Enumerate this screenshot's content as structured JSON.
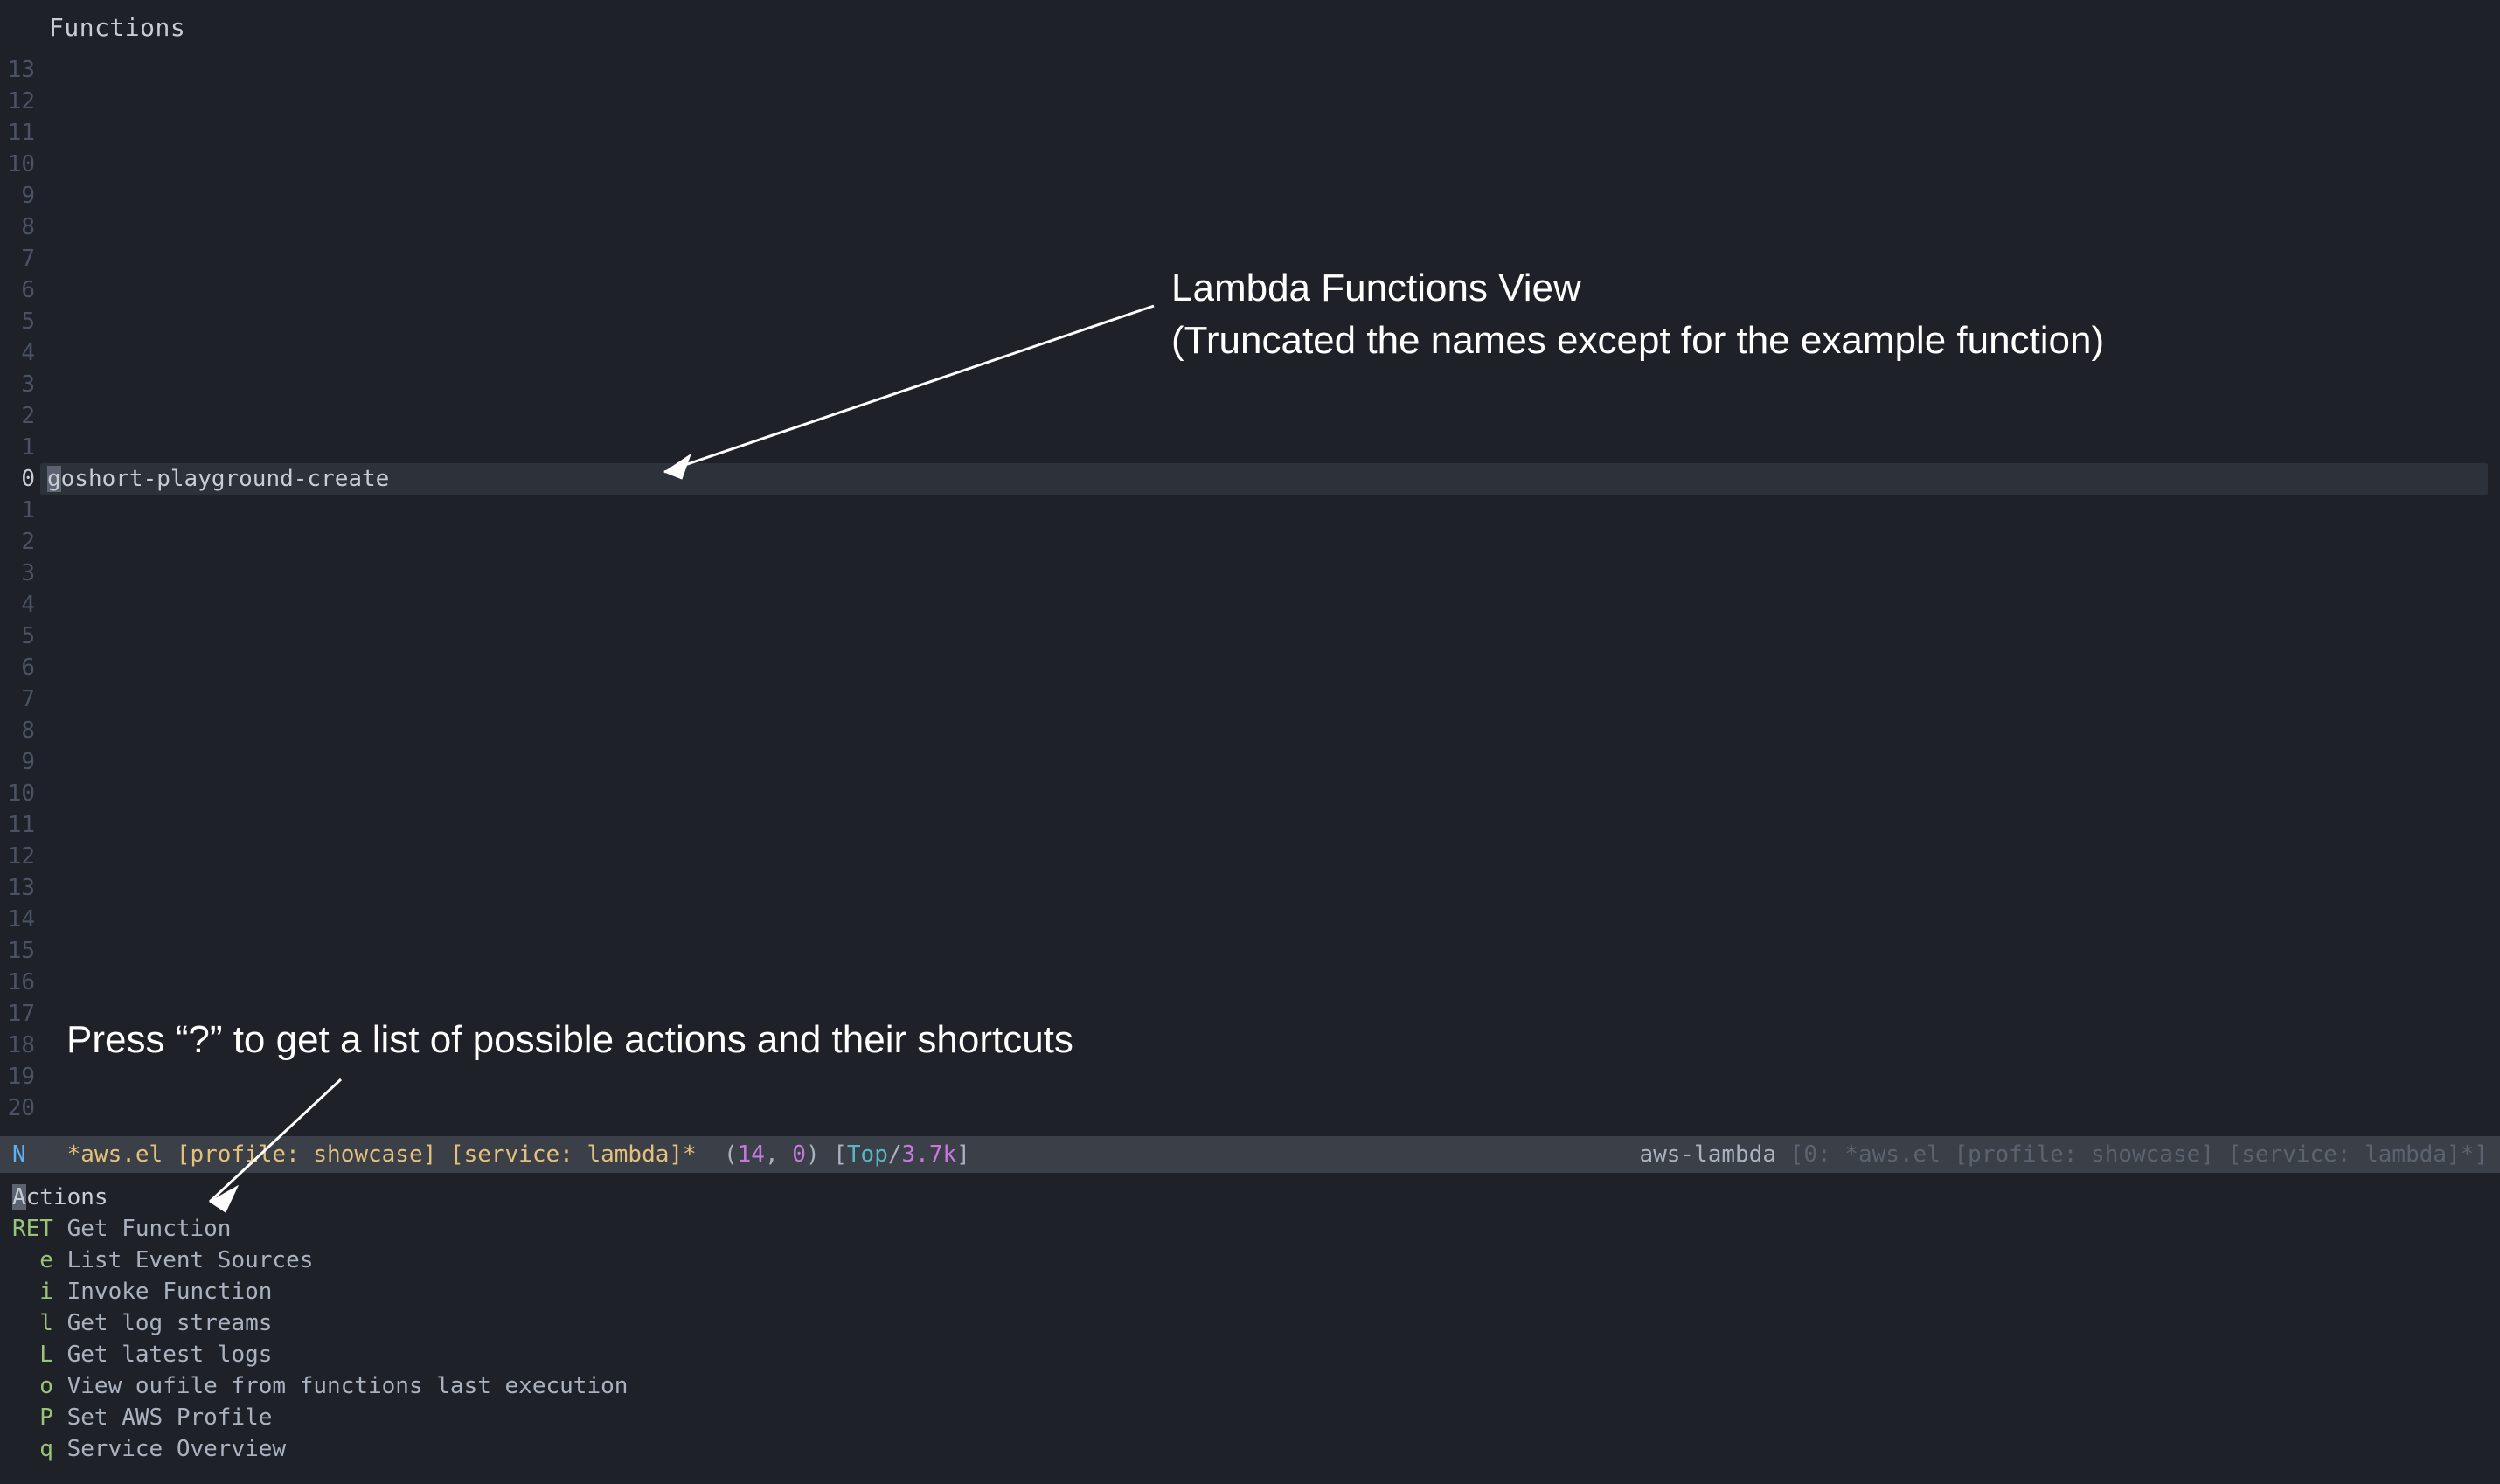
{
  "header": {
    "title": "Functions"
  },
  "gutter": {
    "lines": [
      "13",
      "12",
      "11",
      "10",
      "9",
      "8",
      "7",
      "6",
      "5",
      "4",
      "3",
      "2",
      "1",
      "0",
      "1",
      "2",
      "3",
      "4",
      "5",
      "6",
      "7",
      "8",
      "9",
      "10",
      "11",
      "12",
      "13",
      "14",
      "15",
      "16",
      "17",
      "18",
      "19",
      "20"
    ],
    "currentIndex": 13
  },
  "currentLine": {
    "first_char": "g",
    "rest": "oshort-playground-create"
  },
  "modeline": {
    "mode": "N",
    "buffer": "*aws.el [profile: showcase] [service: lambda]*",
    "row": "14",
    "col": "0",
    "pos": "Top",
    "size": "3.7k",
    "right_mode": "aws-lambda",
    "right_ctx": "[0: *aws.el [profile: showcase] [service: lambda]*]"
  },
  "actions": {
    "heading_first": "A",
    "heading_rest": "ctions",
    "items": [
      {
        "key": "RET",
        "label": "Get Function"
      },
      {
        "key": "e",
        "label": "List Event Sources"
      },
      {
        "key": "i",
        "label": "Invoke Function"
      },
      {
        "key": "l",
        "label": "Get log streams"
      },
      {
        "key": "L",
        "label": "Get latest logs"
      },
      {
        "key": "o",
        "label": "View oufile from functions last execution"
      },
      {
        "key": "P",
        "label": "Set AWS Profile"
      },
      {
        "key": "q",
        "label": "Service Overview"
      }
    ]
  },
  "annotations": {
    "top_line1": "Lambda Functions View",
    "top_line2": "(Truncated the names except for the example function)",
    "bottom": "Press “?” to get a list of possible actions and their shortcuts"
  }
}
